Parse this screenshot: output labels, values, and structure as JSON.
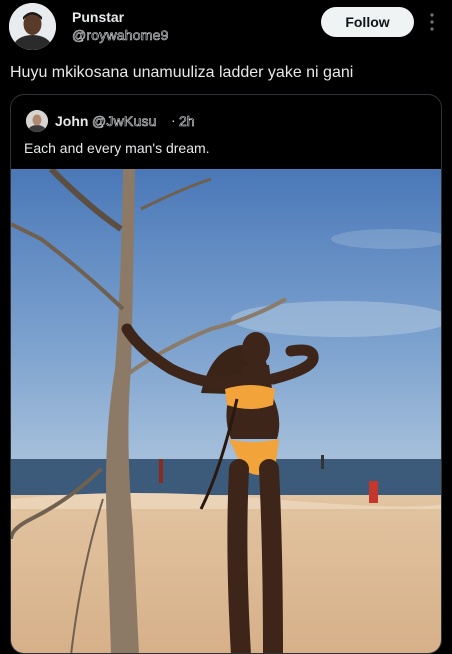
{
  "author": {
    "name": "Punstar",
    "handle": "@roywahome9"
  },
  "follow_label": "Follow",
  "tweet": {
    "text": "Huyu mkikosana unamuuliza ladder yake ni gani"
  },
  "quoted": {
    "name": "John",
    "handle": "@JwKusu",
    "separator": "·",
    "time": "2h",
    "text": "Each and every man's dream."
  },
  "colors": {
    "background": "#000000",
    "text": "#e7e9ea",
    "follow_bg": "#eff3f4",
    "border": "#2f3336"
  },
  "icons": {
    "more": "more-vertical-icon"
  }
}
